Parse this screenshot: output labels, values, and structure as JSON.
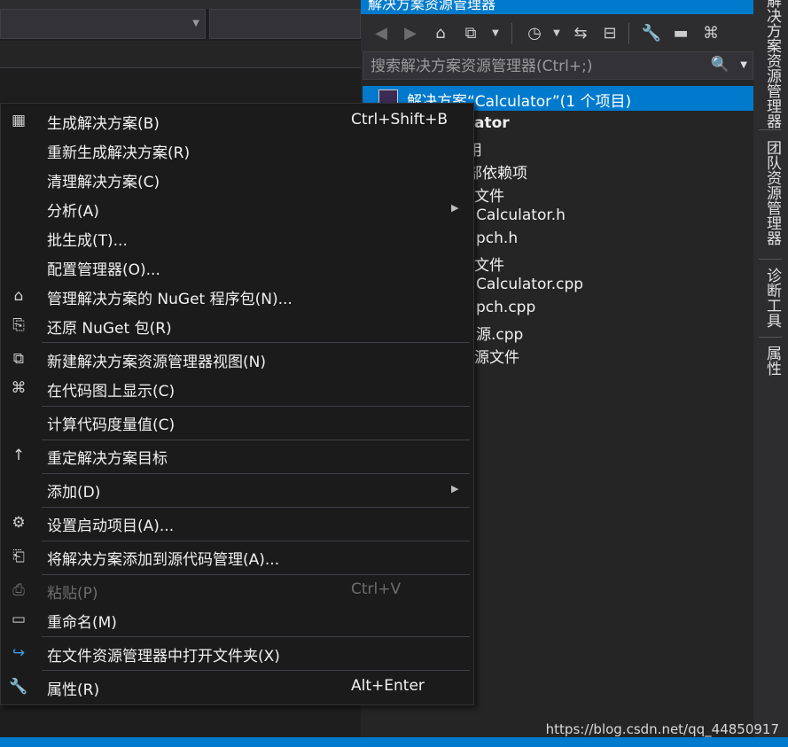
{
  "solution_explorer": {
    "title": "解决方案资源管理器",
    "window_controls": "▾ ✕",
    "search_placeholder": "搜索解决方案资源管理器(Ctrl+;)",
    "selected_item": "解决方案“Calculator”(1 个项目)",
    "tree_fragments": [
      {
        "text": "ator",
        "bold": true
      },
      {
        "text": "用",
        "bold": false
      },
      {
        "text": "部依赖项",
        "bold": false
      },
      {
        "text": "文件",
        "bold": false
      },
      {
        "text": "Calculator.h",
        "bold": false
      },
      {
        "text": "pch.h",
        "bold": false
      },
      {
        "text": "文件",
        "bold": false
      },
      {
        "text": "Calculator.cpp",
        "bold": false
      },
      {
        "text": "pch.cpp",
        "bold": false
      },
      {
        "text": "源.cpp",
        "bold": false
      },
      {
        "text": "源文件",
        "bold": false
      }
    ],
    "toolbar_icons": [
      "back-arrow-icon",
      "forward-arrow-icon",
      "home-icon",
      "switch-views-icon",
      "dropdown-icon",
      "pending-changes-filter-icon",
      "dropdown-icon",
      "sync-icon",
      "collapse-all-icon",
      "properties-wrench-icon",
      "preview-icon",
      "code-map-icon"
    ]
  },
  "side_tabs": [
    "解决方案资源管理器",
    "团队资源管理器",
    "诊断工具",
    "属性"
  ],
  "context_menu": {
    "items": [
      {
        "icon": "build-icon",
        "label": "生成解决方案(B)",
        "shortcut": "Ctrl+Shift+B",
        "submenu": false,
        "enabled": true
      },
      {
        "icon": "",
        "label": "重新生成解决方案(R)",
        "shortcut": "",
        "submenu": false,
        "enabled": true
      },
      {
        "icon": "",
        "label": "清理解决方案(C)",
        "shortcut": "",
        "submenu": false,
        "enabled": true
      },
      {
        "icon": "",
        "label": "分析(A)",
        "shortcut": "",
        "submenu": true,
        "enabled": true
      },
      {
        "icon": "",
        "label": "批生成(T)...",
        "shortcut": "",
        "submenu": false,
        "enabled": true
      },
      {
        "icon": "",
        "label": "配置管理器(O)...",
        "shortcut": "",
        "submenu": false,
        "enabled": true
      },
      {
        "icon": "nuget-package-icon",
        "label": "管理解决方案的 NuGet 程序包(N)...",
        "shortcut": "",
        "submenu": false,
        "enabled": true
      },
      {
        "icon": "restore-icon",
        "label": "还原 NuGet 包(R)",
        "shortcut": "",
        "submenu": false,
        "enabled": true
      },
      {
        "icon": "new-view-icon",
        "label": "新建解决方案资源管理器视图(N)",
        "shortcut": "",
        "submenu": false,
        "enabled": true
      },
      {
        "icon": "code-map-icon",
        "label": "在代码图上显示(C)",
        "shortcut": "",
        "submenu": false,
        "enabled": true
      },
      {
        "icon": "",
        "label": "计算代码度量值(C)",
        "shortcut": "",
        "submenu": false,
        "enabled": true
      },
      {
        "icon": "up-arrow-icon",
        "label": "重定解决方案目标",
        "shortcut": "",
        "submenu": false,
        "enabled": true
      },
      {
        "icon": "",
        "label": "添加(D)",
        "shortcut": "",
        "submenu": true,
        "enabled": true
      },
      {
        "icon": "gear-icon",
        "label": "设置启动项目(A)...",
        "shortcut": "",
        "submenu": false,
        "enabled": true
      },
      {
        "icon": "add-to-source-control-icon",
        "label": "将解决方案添加到源代码管理(A)...",
        "shortcut": "",
        "submenu": false,
        "enabled": true
      },
      {
        "icon": "paste-icon",
        "label": "粘贴(P)",
        "shortcut": "Ctrl+V",
        "submenu": false,
        "enabled": false
      },
      {
        "icon": "rename-icon",
        "label": "重命名(M)",
        "shortcut": "",
        "submenu": false,
        "enabled": true
      },
      {
        "icon": "open-folder-arrow-icon",
        "label": "在文件资源管理器中打开文件夹(X)",
        "shortcut": "",
        "submenu": false,
        "enabled": true
      },
      {
        "icon": "wrench-icon",
        "label": "属性(R)",
        "shortcut": "Alt+Enter",
        "submenu": false,
        "enabled": true
      }
    ]
  },
  "watermark": "https://blog.csdn.net/qq_44850917",
  "colors": {
    "accent": "#007acc",
    "menu_bg": "#1b1b1c",
    "panel_bg": "#252526"
  }
}
